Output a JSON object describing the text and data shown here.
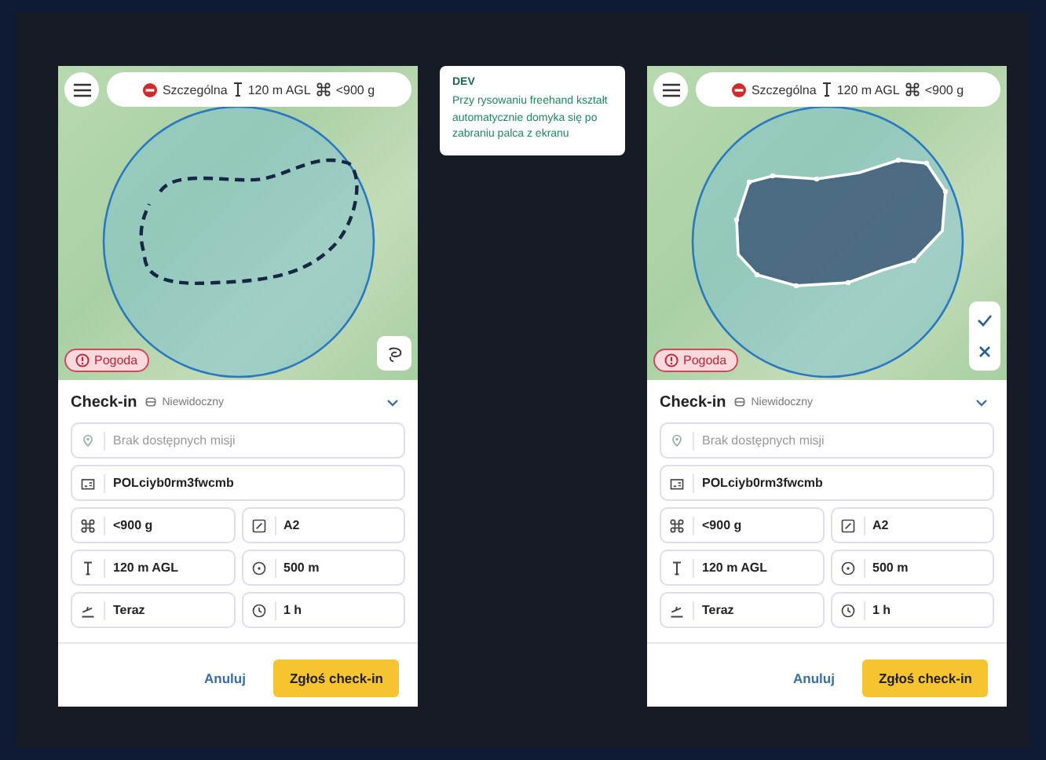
{
  "screens": [
    {
      "kind": "drawing",
      "top_bar": {
        "zone": "Szczególna",
        "altitude": "120 m AGL",
        "weight": "<900 g"
      },
      "weather_button": "Pogoda",
      "checkin": {
        "title": "Check-in",
        "visibility": "Niewidoczny",
        "fields": [
          {
            "kind": "mission",
            "placeholder": "Brak dostępnych misji"
          },
          {
            "kind": "operator",
            "value": "POLciyb0rm3fwcmb"
          },
          {
            "kind": "weight",
            "value": "<900 g"
          },
          {
            "kind": "category",
            "value": "A2"
          },
          {
            "kind": "altitude",
            "value": "120 m AGL"
          },
          {
            "kind": "radius",
            "value": "500 m"
          },
          {
            "kind": "start",
            "value": "Teraz"
          },
          {
            "kind": "duration",
            "value": "1 h"
          }
        ],
        "buttons": {
          "cancel": "Anuluj",
          "submit": "Zgłoś check-in"
        }
      }
    },
    {
      "kind": "closed",
      "top_bar": {
        "zone": "Szczególna",
        "altitude": "120 m AGL",
        "weight": "<900 g"
      },
      "weather_button": "Pogoda",
      "checkin": {
        "title": "Check-in",
        "visibility": "Niewidoczny",
        "fields": [
          {
            "kind": "mission",
            "placeholder": "Brak dostępnych misji"
          },
          {
            "kind": "operator",
            "value": "POLciyb0rm3fwcmb"
          },
          {
            "kind": "weight",
            "value": "<900 g"
          },
          {
            "kind": "category",
            "value": "A2"
          },
          {
            "kind": "altitude",
            "value": "120 m AGL"
          },
          {
            "kind": "radius",
            "value": "500 m"
          },
          {
            "kind": "start",
            "value": "Teraz"
          },
          {
            "kind": "duration",
            "value": "1 h"
          }
        ],
        "buttons": {
          "cancel": "Anuluj",
          "submit": "Zgłoś check-in"
        }
      }
    }
  ],
  "note": {
    "label": "DEV",
    "text": "Przy rysowaniu freehand kształt automatycznie domyka się po zabraniu palca z ekranu"
  }
}
